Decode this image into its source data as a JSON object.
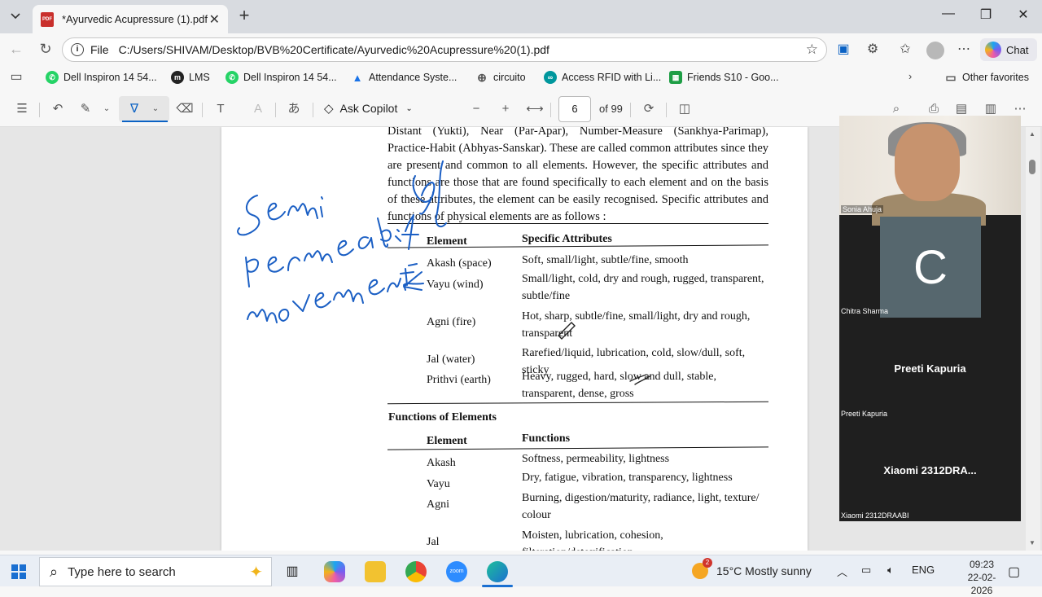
{
  "browser": {
    "tab_title": "*Ayurvedic Acupressure (1).pdf",
    "address_prefix": "File",
    "address_url": "C:/Users/SHIVAM/Desktop/BVB%20Certificate/Ayurvedic%20Acupressure%20(1).pdf",
    "chat_label": "Chat",
    "favorites": [
      {
        "label": "Dell Inspiron 14 54...",
        "icon": "whatsapp-icon",
        "color": "#25d366"
      },
      {
        "label": "LMS",
        "icon": "lms-icon",
        "color": "#222222"
      },
      {
        "label": "Dell Inspiron 14 54...",
        "icon": "whatsapp-icon",
        "color": "#25d366"
      },
      {
        "label": "Attendance Syste...",
        "icon": "drive-icon",
        "color": "#1a73e8"
      },
      {
        "label": "circuito",
        "icon": "globe-icon",
        "color": "#555555"
      },
      {
        "label": "Access RFID with Li...",
        "icon": "arduino-icon",
        "color": "#00979d"
      },
      {
        "label": "Friends S10 - Goo...",
        "icon": "sheets-icon",
        "color": "#1e9e45"
      }
    ],
    "other_favorites": "Other favorites"
  },
  "pdf_toolbar": {
    "ask_copilot": "Ask Copilot",
    "page_current": "6",
    "page_total": "of 99"
  },
  "document": {
    "paragraph": "Distant (Yukti), Near (Par-Apar), Number-Measure (Sankhya-Parimap), Practice-Habit (Abhyas-Sanskar). These are called common attributes since they are present and common to all elements. However, the specific attributes and functions are those that are found specifically to each element and on the basis of these attributes, the element can be easily recognised. Specific attributes and functions of physical elements are as follows :",
    "table1": {
      "col_element": "Element",
      "col_attrs": "Specific Attributes",
      "rows": [
        {
          "element": "Akash (space)",
          "attrs": "Soft, small/light, subtle/fine, smooth"
        },
        {
          "element": "Vayu (wind)",
          "attrs": "Small/light, cold, dry and rough, rugged, transparent, subtle/fine"
        },
        {
          "element": "Agni (fire)",
          "attrs": "Hot, sharp, subtle/fine, small/light, dry and rough, transparent"
        },
        {
          "element": "Jal (water)",
          "attrs": "Rarefied/liquid, lubrication, cold, slow/dull, soft, sticky"
        },
        {
          "element": "Prithvi (earth)",
          "attrs": "Heavy, rugged, hard, slow and dull, stable, transparent, dense, gross"
        }
      ]
    },
    "section2_title": "Functions of Elements",
    "table2": {
      "col_element": "Element",
      "col_functions": "Functions",
      "rows": [
        {
          "element": "Akash",
          "functions": "Softness, permeability, lightness"
        },
        {
          "element": "Vayu",
          "functions": "Dry, fatigue, vibration, transparency, lightness"
        },
        {
          "element": "Agni",
          "functions": "Burning, digestion/maturity, radiance, light, texture/ colour"
        },
        {
          "element": "Jal",
          "functions": "Moisten, lubrication, cohesion, filteration/detoxification,"
        }
      ]
    }
  },
  "meeting": {
    "sonia_label": "Sonia Ahuja",
    "chitra_initial": "C",
    "chitra_label": "Chitra Sharma",
    "preeti_name": "Preeti Kapuria",
    "preeti_label": "Preeti Kapuria",
    "xiaomi_name": "Xiaomi  2312DRA...",
    "xiaomi_label": "Xiaomi 2312DRAABI"
  },
  "taskbar": {
    "search_placeholder": "Type here to search",
    "weather_badge": "2",
    "weather": "15°C  Mostly sunny",
    "lang": "ENG",
    "time": "09:23",
    "date": "22-02-2026"
  }
}
